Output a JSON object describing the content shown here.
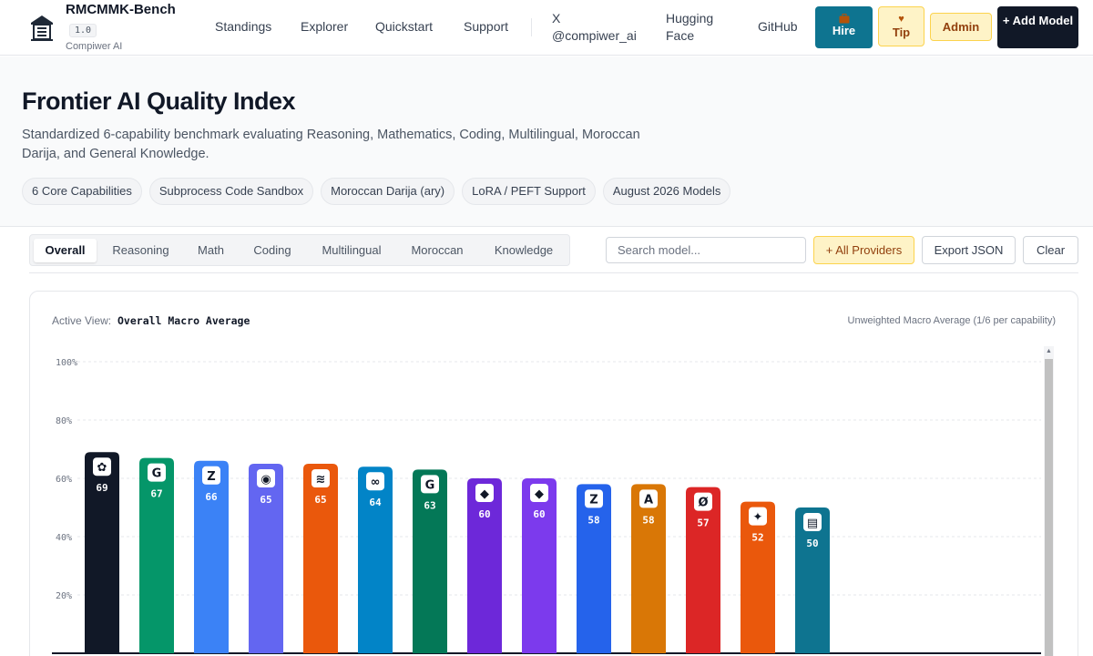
{
  "nav": {
    "brand_title": "RMCMMK-Bench",
    "version": "1.0",
    "company": "Compiwer AI",
    "links": [
      {
        "label": "Standings"
      },
      {
        "label": "Explorer"
      },
      {
        "label": "Quickstart"
      },
      {
        "label": "Support"
      },
      {
        "label": "X @compiwer_ai"
      },
      {
        "label": "Hugging Face"
      },
      {
        "label": "GitHub"
      }
    ],
    "hire": {
      "icon": "briefcase-icon",
      "label": "Hire"
    },
    "tip": {
      "icon": "heart-icon",
      "label": "Tip"
    },
    "admin_label": "Admin",
    "add_model_label": "+ Add Model"
  },
  "hero": {
    "title": "Frontier AI Quality Index",
    "subtitle": "Standardized 6-capability benchmark evaluating Reasoning, Mathematics, Coding, Multilingual, Moroccan Darija, and General Knowledge.",
    "chips": [
      "6 Core Capabilities",
      "Subprocess Code Sandbox",
      "Moroccan Darija (ary)",
      "LoRA / PEFT Support",
      "August 2026 Models"
    ]
  },
  "toolbar": {
    "tabs": [
      "Overall",
      "Reasoning",
      "Math",
      "Coding",
      "Multilingual",
      "Moroccan",
      "Knowledge"
    ],
    "active_tab": "Overall",
    "search_placeholder": "Search model...",
    "search_value": "",
    "providers_label": "+ All Providers",
    "export_label": "Export JSON",
    "clear_label": "Clear"
  },
  "chart_card": {
    "active_view_label": "Active View:",
    "active_view_value": "Overall Macro Average",
    "note": "Unweighted Macro Average (1/6 per capability)"
  },
  "chart_data": {
    "type": "bar",
    "ylim": [
      0,
      100
    ],
    "yticks": [
      "20%",
      "40%",
      "60%",
      "80%",
      "100%"
    ],
    "ytick_values": [
      20,
      40,
      60,
      80,
      100
    ],
    "grid": true,
    "values": [
      69,
      67,
      66,
      65,
      65,
      64,
      63,
      60,
      60,
      58,
      58,
      57,
      52,
      50
    ],
    "bar_colors": [
      "#111827",
      "#059669",
      "#3b82f6",
      "#6366f1",
      "#ea580c",
      "#0284c7",
      "#047857",
      "#6d28d9",
      "#7c3aed",
      "#2563eb",
      "#d97706",
      "#dc2626",
      "#ea580c",
      "#0e7490"
    ],
    "bar_icons": [
      "openai-icon",
      "google-icon",
      "zhipu-icon",
      "perplexity-icon",
      "audio-wave-icon",
      "meta-icon",
      "google-icon",
      "deepseek-icon",
      "deepseek-icon",
      "zhipu-icon",
      "anthropic-icon",
      "no-symbol-icon",
      "sparkle-icon",
      "compiwer-icon"
    ]
  }
}
